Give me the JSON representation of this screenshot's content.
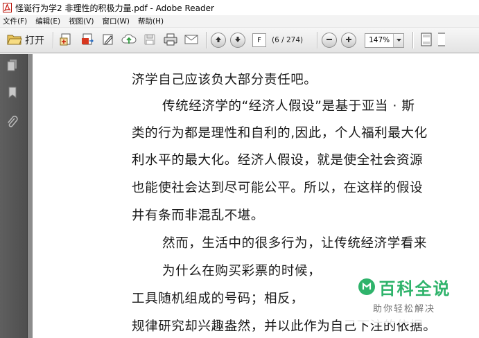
{
  "window": {
    "title": "怪诞行为学2 非理性的积极力量.pdf - Adobe Reader"
  },
  "menu": {
    "items": [
      "文件(F)",
      "编辑(E)",
      "视图(V)",
      "窗口(W)",
      "帮助(H)"
    ]
  },
  "toolbar": {
    "open_label": "打开",
    "page_value": "F",
    "page_count": "(6 / 274)",
    "zoom_value": "147%"
  },
  "document": {
    "lines": [
      "济学自己应该负大部分责任吧。",
      "传统经济学的“经济人假设”是基于亚当 · 斯",
      "类的行为都是理性和自利的,因此，个人福利最大化",
      "利水平的最大化。经济人假设，就是使全社会资源",
      "也能使社会达到尽可能公平。所以，在这样的假设",
      "井有条而非混乱不堪。",
      "然而，生活中的很多行为，让传统经济学看来",
      "为什么在购买彩票的时候，",
      "工具随机组成的号码；相反，",
      "规律研究却兴趣盎然，并以此作为自己下注的依据。"
    ]
  },
  "watermark": {
    "title": "百科全说",
    "subtitle": "助你轻松解决"
  },
  "colors": {
    "watermark_green": "#2fb36b",
    "nav_panel": "#555555",
    "toolbar": "#e8e8e8"
  },
  "icons": {
    "toolbar": [
      "open-folder-icon",
      "create-pdf-icon",
      "export-pdf-icon",
      "edit-icon",
      "upload-cloud-icon",
      "save-icon",
      "print-icon",
      "email-icon",
      "page-up-icon",
      "page-down-icon",
      "zoom-out-icon",
      "zoom-in-icon",
      "fit-page-icon"
    ],
    "nav": [
      "pages-icon",
      "bookmarks-icon",
      "attachments-icon"
    ]
  }
}
